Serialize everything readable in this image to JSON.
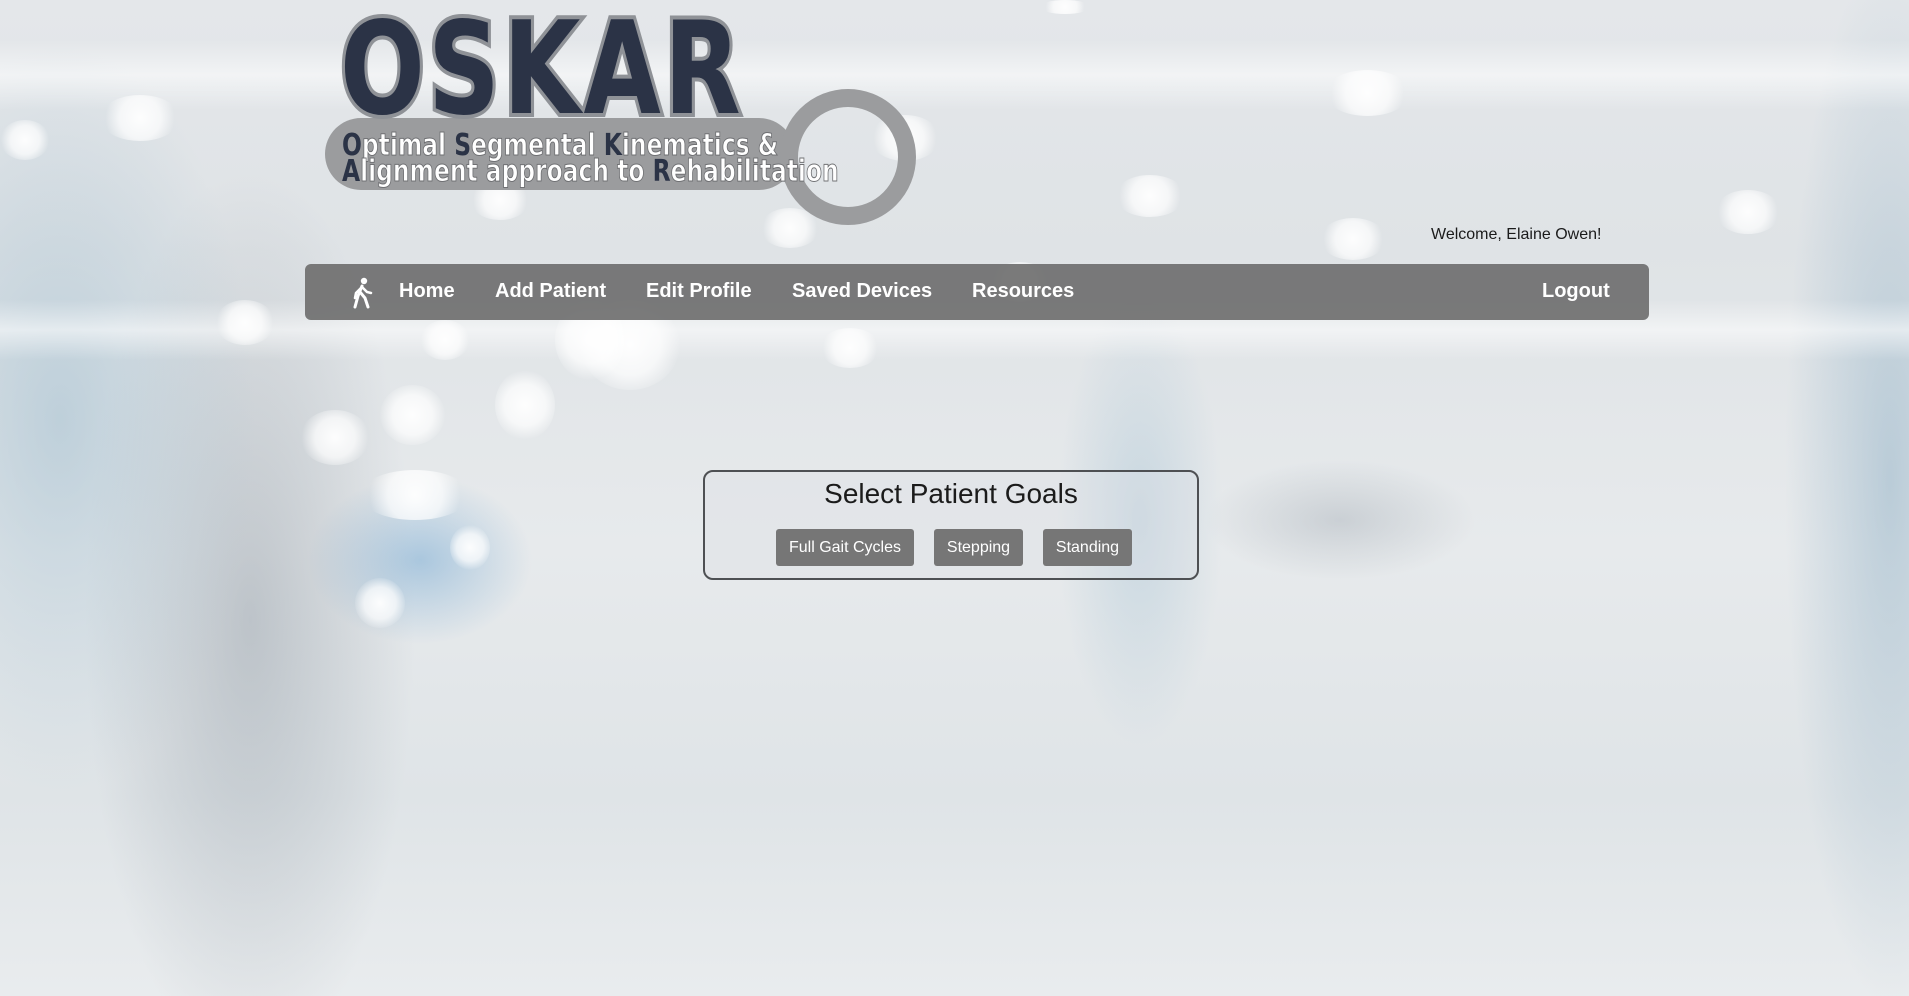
{
  "logo": {
    "title": "OSKAR",
    "line1": [
      {
        "cap": "O",
        "rest": "ptimal "
      },
      {
        "cap": "S",
        "rest": "egmental "
      },
      {
        "cap": "K",
        "rest": "inematics &"
      }
    ],
    "line2": [
      {
        "cap": "A",
        "rest": "lignment approach to "
      },
      {
        "cap": "R",
        "rest": "ehabilitation"
      }
    ]
  },
  "welcome": "Welcome, Elaine Owen!",
  "nav": {
    "icon": "walking-person-icon",
    "items": [
      "Home",
      "Add Patient",
      "Edit Profile",
      "Saved Devices",
      "Resources"
    ],
    "logout": "Logout"
  },
  "goals": {
    "title": "Select Patient Goals",
    "buttons": [
      "Full Gait Cycles",
      "Stepping",
      "Standing"
    ]
  },
  "colors": {
    "navbar": "#707070",
    "button": "#767676",
    "logo_dark": "#2b3346",
    "logo_grey": "#9b9c9e"
  }
}
